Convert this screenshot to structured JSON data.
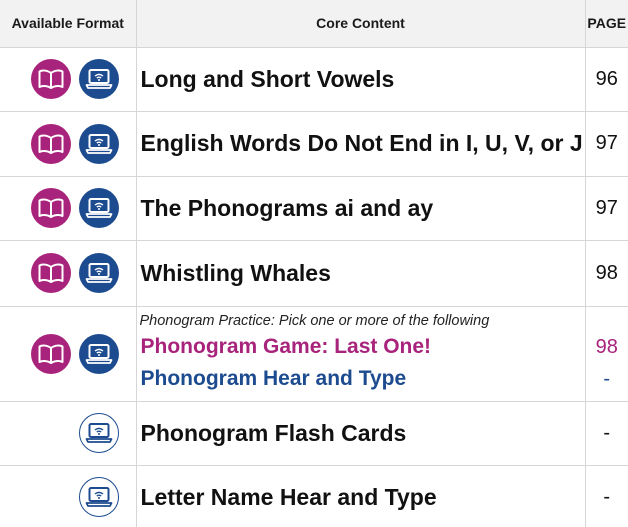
{
  "header": {
    "format_label": "Available Format",
    "content_label": "Core Content",
    "page_label": "PAGE"
  },
  "colors": {
    "book": "#a8237b",
    "digital": "#1d4b8f"
  },
  "icons": {
    "book": "open-book-icon",
    "digital": "laptop-wifi-icon"
  },
  "rows": [
    {
      "formats": [
        "book",
        "digital"
      ],
      "title": "Long and Short Vowels",
      "page": "96"
    },
    {
      "formats": [
        "book",
        "digital"
      ],
      "title": "English Words Do Not End in I, U, V, or J",
      "page": "97"
    },
    {
      "formats": [
        "book",
        "digital"
      ],
      "title": "The Phonograms ai and ay",
      "page": "97"
    },
    {
      "formats": [
        "book",
        "digital"
      ],
      "title": "Whistling Whales",
      "page": "98"
    },
    {
      "formats": [
        "book",
        "digital"
      ],
      "note": "Phonogram Practice: Pick one or more of the following",
      "options": [
        {
          "title": "Phonogram Game: Last One!",
          "page": "98"
        },
        {
          "title": "Phonogram Hear and Type",
          "page": "-"
        }
      ]
    },
    {
      "formats": [
        "digital-outline"
      ],
      "title": "Phonogram Flash Cards",
      "page": "-"
    },
    {
      "formats": [
        "digital-outline"
      ],
      "title": "Letter Name Hear and Type",
      "page": "-"
    }
  ]
}
